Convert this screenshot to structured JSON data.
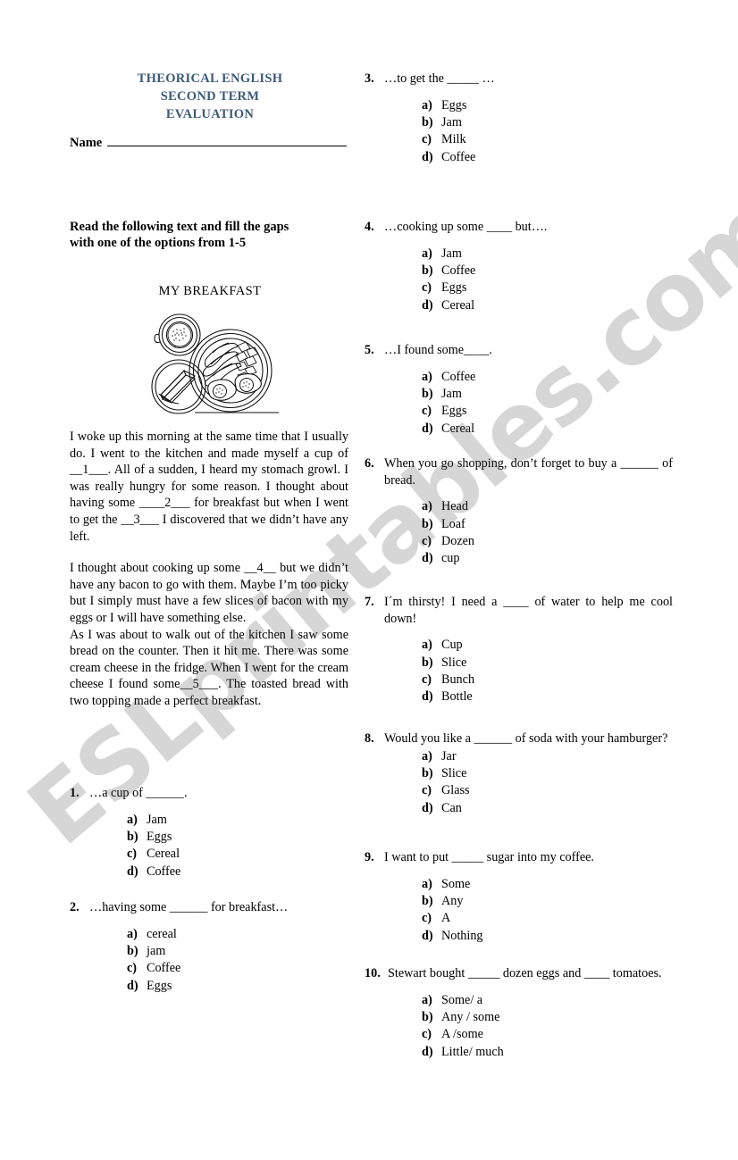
{
  "document": {
    "title_lines": [
      "THEORICAL ENGLISH",
      "SECOND TERM",
      "EVALUATION"
    ],
    "title_color": "#3c5a78",
    "name_label": "Name",
    "instructions_line1": "Read the following text and fill the gaps",
    "instructions_line2": "with one of the options from 1-5",
    "passage_title": "MY BREAKFAST",
    "figure_name": "breakfast-illustration",
    "watermark": "ESLprintables.com"
  },
  "passage": {
    "paragraphs": [
      "I woke up this morning at the same time that I usually do. I went to the kitchen and made myself a cup of __1___. All of a sudden, I heard my stomach growl. I was really hungry for some reason. I thought about having some ____2___ for breakfast but when I went to get the __3___ I discovered that we didn’t have any left.",
      "I thought about cooking up some __4__ but we didn’t have any bacon to go with them. Maybe I’m too picky but I simply must have a few slices of bacon with my eggs or I will have something else.",
      "As I was about to walk out of the kitchen I saw some bread on the counter. Then it hit me. There was some cream cheese in the fridge. When I went for the cream cheese I found some__5___. The toasted bread with two topping made a perfect breakfast."
    ]
  },
  "questions": [
    {
      "number": "1.",
      "text": "…a cup of ______.",
      "options": [
        {
          "letter": "a)",
          "text": "Jam"
        },
        {
          "letter": "b)",
          "text": "Eggs"
        },
        {
          "letter": "c)",
          "text": "Cereal"
        },
        {
          "letter": "d)",
          "text": "Coffee"
        }
      ]
    },
    {
      "number": "2.",
      "text": "…having some ______ for breakfast…",
      "options": [
        {
          "letter": "a)",
          "text": "cereal"
        },
        {
          "letter": "b)",
          "text": "jam"
        },
        {
          "letter": "c)",
          "text": "Coffee"
        },
        {
          "letter": "d)",
          "text": "Eggs"
        }
      ]
    },
    {
      "number": "3.",
      "text": "…to get the _____ …",
      "options": [
        {
          "letter": "a)",
          "text": "Eggs"
        },
        {
          "letter": "b)",
          "text": "Jam"
        },
        {
          "letter": "c)",
          "text": "Milk"
        },
        {
          "letter": "d)",
          "text": "Coffee"
        }
      ]
    },
    {
      "number": "4.",
      "text": "…cooking up some ____ but….",
      "options": [
        {
          "letter": "a)",
          "text": "Jam"
        },
        {
          "letter": "b)",
          "text": "Coffee"
        },
        {
          "letter": "c)",
          "text": "Eggs"
        },
        {
          "letter": "d)",
          "text": "Cereal"
        }
      ]
    },
    {
      "number": "5.",
      "text": "…I found some____.",
      "options": [
        {
          "letter": "a)",
          "text": "Coffee"
        },
        {
          "letter": "b)",
          "text": "Jam"
        },
        {
          "letter": "c)",
          "text": "Eggs"
        },
        {
          "letter": "d)",
          "text": "Cereal"
        }
      ]
    },
    {
      "number": "6.",
      "text": "When you go shopping, don’t forget to buy a ______ of bread.",
      "options": [
        {
          "letter": "a)",
          "text": "Head"
        },
        {
          "letter": "b)",
          "text": "Loaf"
        },
        {
          "letter": "c)",
          "text": "Dozen"
        },
        {
          "letter": "d)",
          "text": "cup"
        }
      ]
    },
    {
      "number": "7.",
      "text": "I´m thirsty! I need a ____ of water to help me cool down!",
      "options": [
        {
          "letter": "a)",
          "text": "Cup"
        },
        {
          "letter": "b)",
          "text": "Slice"
        },
        {
          "letter": "c)",
          "text": "Bunch"
        },
        {
          "letter": "d)",
          "text": "Bottle"
        }
      ]
    },
    {
      "number": "8.",
      "text": "Would you like a ______ of soda with your hamburger?",
      "options": [
        {
          "letter": "a)",
          "text": "Jar"
        },
        {
          "letter": "b)",
          "text": "Slice"
        },
        {
          "letter": "c)",
          "text": "Glass"
        },
        {
          "letter": "d)",
          "text": "Can"
        }
      ]
    },
    {
      "number": "9.",
      "text": "I want to put _____ sugar into my coffee.",
      "options": [
        {
          "letter": "a)",
          "text": "Some"
        },
        {
          "letter": "b)",
          "text": "Any"
        },
        {
          "letter": "c)",
          "text": "A"
        },
        {
          "letter": "d)",
          "text": "Nothing"
        }
      ]
    },
    {
      "number": "10.",
      "text": "Stewart bought _____ dozen eggs and ____ tomatoes.",
      "options": [
        {
          "letter": "a)",
          "text": "Some/ a"
        },
        {
          "letter": "b)",
          "text": "Any / some"
        },
        {
          "letter": "c)",
          "text": "A /some"
        },
        {
          "letter": "d)",
          "text": "Little/ much"
        }
      ]
    }
  ]
}
